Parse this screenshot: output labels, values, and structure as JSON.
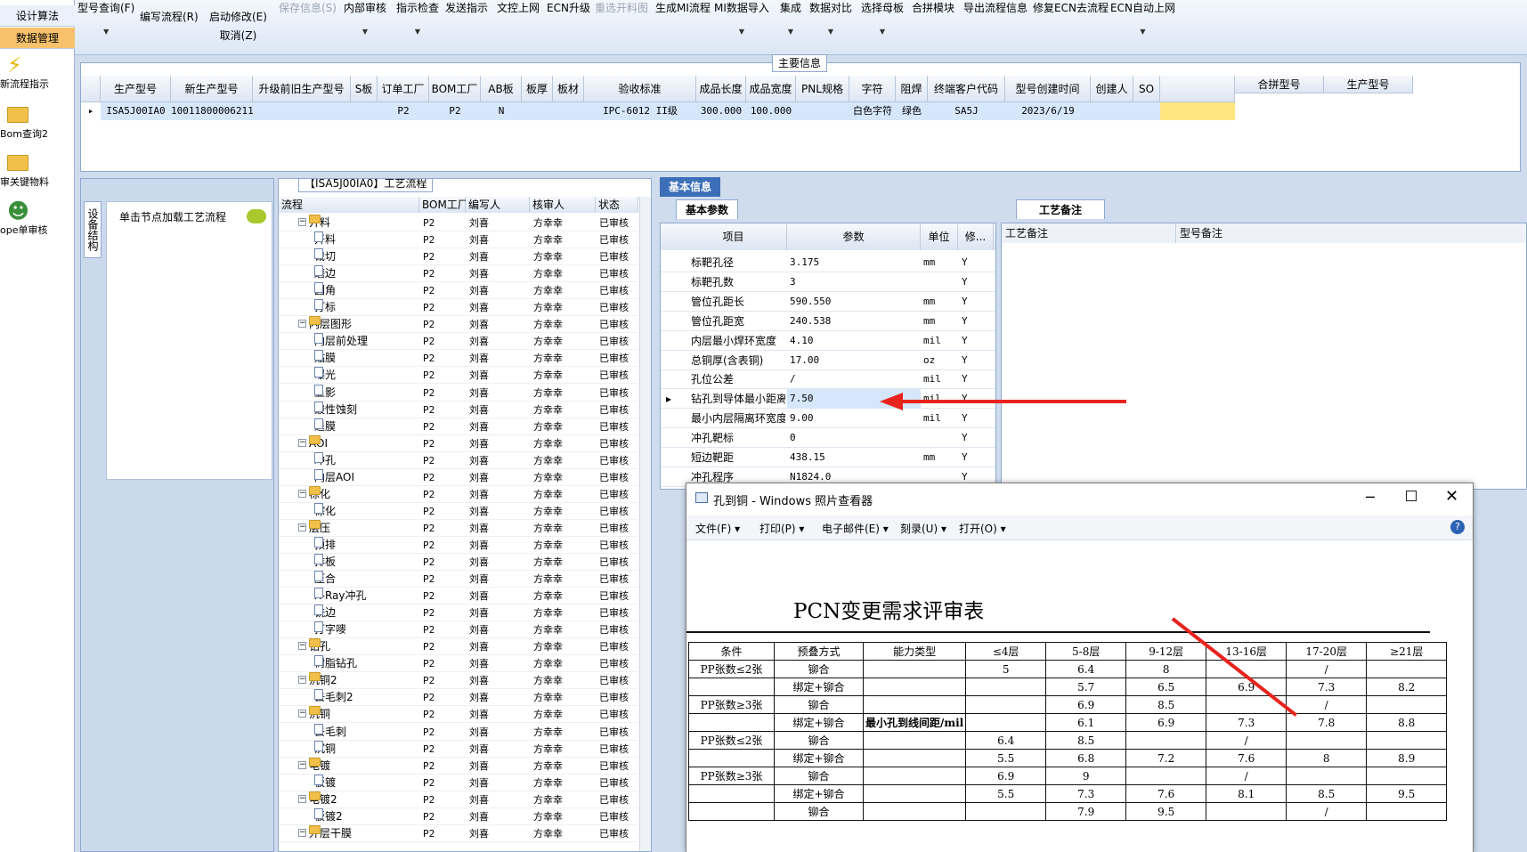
{
  "sidebar": {
    "top_items": [
      "设计算法",
      "数据管理"
    ],
    "icon_items": [
      {
        "label": "新流程指示",
        "icon": "lightning-icon"
      },
      {
        "label": "Bom查询2",
        "icon": "folder-icon"
      },
      {
        "label": "审关键物料",
        "icon": "folder-icon"
      },
      {
        "label": "ope单审核",
        "icon": "user-icon"
      }
    ]
  },
  "toolbar": {
    "items": [
      {
        "label": "型号查询(F)",
        "dd": true
      },
      {
        "label": "编写流程(R)"
      },
      {
        "label": "启动修改(E)",
        "sub": "取消(Z)"
      },
      {
        "label": "保存信息(S)",
        "disabled": true
      },
      {
        "label": "内部审核",
        "dd": true
      },
      {
        "label": "指示检查",
        "dd": true
      },
      {
        "label": "发送指示"
      },
      {
        "label": "文控上网"
      },
      {
        "label": "ECN升级"
      },
      {
        "label": "重选开料图",
        "disabled": true
      },
      {
        "label": "生成MI流程"
      },
      {
        "label": "MI数据导入",
        "dd": true
      },
      {
        "label": "集成",
        "dd": true
      },
      {
        "label": "数据对比",
        "dd": true
      },
      {
        "label": "选择母板",
        "dd": true
      },
      {
        "label": "合拼模块"
      },
      {
        "label": "导出流程信息"
      },
      {
        "label": "修复ECN去流程"
      },
      {
        "label": "ECN自动上网",
        "dd": true
      }
    ]
  },
  "main_info": {
    "caption": "主要信息",
    "columns": [
      "生产型号",
      "新生产型号",
      "升级前旧生产型号",
      "S板",
      "订单工厂",
      "BOM工厂",
      "AB板",
      "板厚",
      "板材",
      "验收标准",
      "成品长度",
      "成品宽度",
      "PNL规格",
      "字符",
      "阻焊",
      "终端客户代码",
      "型号创建时间",
      "创建人",
      "SO"
    ],
    "row": [
      "ISA5J00IA0",
      "10011800006211",
      "",
      "",
      "P2",
      "P2",
      "N",
      "",
      "",
      "IPC-6012 II级",
      "300.000",
      "100.000",
      "",
      "白色字符",
      "绿色",
      "SA5J",
      "2023/6/19",
      "",
      ""
    ],
    "side_columns": [
      "合拼型号",
      "生产型号"
    ]
  },
  "left_panel": {
    "vertical_tab": "设备结构",
    "node_hint": "单击节点加载工艺流程"
  },
  "process": {
    "caption": "【ISA5J00IA0】工艺流程",
    "columns": [
      "流程",
      "BOM工厂",
      "编写人",
      "核审人",
      "状态"
    ],
    "rows": [
      {
        "name": "开料",
        "folder": true
      },
      {
        "name": "开料"
      },
      {
        "name": "裁切"
      },
      {
        "name": "磨边"
      },
      {
        "name": "圆角"
      },
      {
        "name": "打标"
      },
      {
        "name": "内层图形",
        "folder": true
      },
      {
        "name": "内层前处理"
      },
      {
        "name": "贴膜"
      },
      {
        "name": "曝光"
      },
      {
        "name": "显影"
      },
      {
        "name": "酸性蚀刻"
      },
      {
        "name": "退膜"
      },
      {
        "name": "AOI",
        "folder": true
      },
      {
        "name": "冲孔"
      },
      {
        "name": "内层AOI"
      },
      {
        "name": "棕化",
        "folder": true
      },
      {
        "name": "棕化"
      },
      {
        "name": "层压",
        "folder": true
      },
      {
        "name": "预排"
      },
      {
        "name": "排板"
      },
      {
        "name": "压合"
      },
      {
        "name": "X-Ray冲孔"
      },
      {
        "name": "铣边"
      },
      {
        "name": "打字嘜"
      },
      {
        "name": "钻孔",
        "folder": true
      },
      {
        "name": "树脂钻孔"
      },
      {
        "name": "沉铜2",
        "folder": true
      },
      {
        "name": "去毛刺2"
      },
      {
        "name": "沉铜",
        "folder": true
      },
      {
        "name": "去毛刺"
      },
      {
        "name": "沉铜"
      },
      {
        "name": "电镀",
        "folder": true
      },
      {
        "name": "板镀"
      },
      {
        "name": "电镀2",
        "folder": true
      },
      {
        "name": "板镀2"
      },
      {
        "name": "外层干膜",
        "folder": true
      }
    ],
    "factory": "P2",
    "writer": "刘喜",
    "reviewer": "方幸幸",
    "status": "已审核"
  },
  "basic_info": {
    "tab": "基本信息",
    "sub_tab": "基本参数",
    "columns": [
      "项目",
      "参数",
      "单位",
      "修..."
    ],
    "rows": [
      {
        "item": "标靶孔径",
        "value": "3.175",
        "unit": "mm",
        "flag": "Y"
      },
      {
        "item": "标靶孔数",
        "value": "3",
        "unit": "",
        "flag": "Y"
      },
      {
        "item": "管位孔距长",
        "value": "590.550",
        "unit": "mm",
        "flag": "Y"
      },
      {
        "item": "管位孔距宽",
        "value": "240.538",
        "unit": "mm",
        "flag": "Y"
      },
      {
        "item": "内层最小焊环宽度",
        "value": "4.10",
        "unit": "mil",
        "flag": "Y"
      },
      {
        "item": "总铜厚(含表铜)",
        "value": "17.00",
        "unit": "oz",
        "flag": "Y"
      },
      {
        "item": "孔位公差",
        "value": "/",
        "unit": "mil",
        "flag": "Y"
      },
      {
        "item": "钻孔到导体最小距离",
        "value": "7.50",
        "unit": "mil",
        "flag": "Y",
        "selected": true
      },
      {
        "item": "最小内层隔离环宽度",
        "value": "9.00",
        "unit": "mil",
        "flag": "Y"
      },
      {
        "item": "冲孔靶标",
        "value": "0",
        "unit": "",
        "flag": "Y"
      },
      {
        "item": "短边靶距",
        "value": "438.15",
        "unit": "mm",
        "flag": "Y"
      },
      {
        "item": "冲孔程序",
        "value": "N1824.0",
        "unit": "",
        "flag": "Y"
      }
    ]
  },
  "remarks": {
    "tab": "工艺备注",
    "col1": "工艺备注",
    "col2": "型号备注"
  },
  "viewer": {
    "title": "孔到铜 - Windows 照片查看器",
    "menu": [
      "文件(F)",
      "打印(P)",
      "电子邮件(E)",
      "刻录(U)",
      "打开(O)"
    ],
    "doc_title": "PCN变更需求评审表",
    "table_header": [
      "条件",
      "预叠方式",
      "能力类型",
      "≤4层",
      "5-8层",
      "9-12层",
      "13-16层",
      "17-20层",
      "≥21层"
    ],
    "table_rows": [
      [
        "PP张数≤2张",
        "铆合",
        "",
        "5",
        "6.4",
        "8",
        "",
        "/",
        ""
      ],
      [
        "",
        "绑定+铆合",
        "",
        "",
        "5.7",
        "6.5",
        "6.9",
        "7.3",
        "8.2"
      ],
      [
        "PP张数≥3张",
        "铆合",
        "",
        "",
        "6.9",
        "8.5",
        "",
        "/",
        ""
      ],
      [
        "",
        "绑定+铆合",
        "最小孔到线间距/mil",
        "",
        "6.1",
        "6.9",
        "7.3",
        "7.8",
        "8.8"
      ],
      [
        "PP张数≤2张",
        "铆合",
        "",
        "6.4",
        "8.5",
        "",
        "/",
        "",
        ""
      ],
      [
        "",
        "绑定+铆合",
        "",
        "5.5",
        "6.8",
        "7.2",
        "7.6",
        "8",
        "8.9"
      ],
      [
        "PP张数≥3张",
        "铆合",
        "",
        "6.9",
        "9",
        "",
        "/",
        "",
        ""
      ],
      [
        "",
        "绑定+铆合",
        "",
        "5.5",
        "7.3",
        "7.6",
        "8.1",
        "8.5",
        "9.5"
      ],
      [
        "",
        "铆合",
        "",
        "",
        "7.9",
        "9.5",
        "",
        "/",
        ""
      ]
    ]
  },
  "colors": {
    "accent": "#e8231d",
    "selection": "#d6e6fb",
    "highlight": "#f7c26b"
  }
}
